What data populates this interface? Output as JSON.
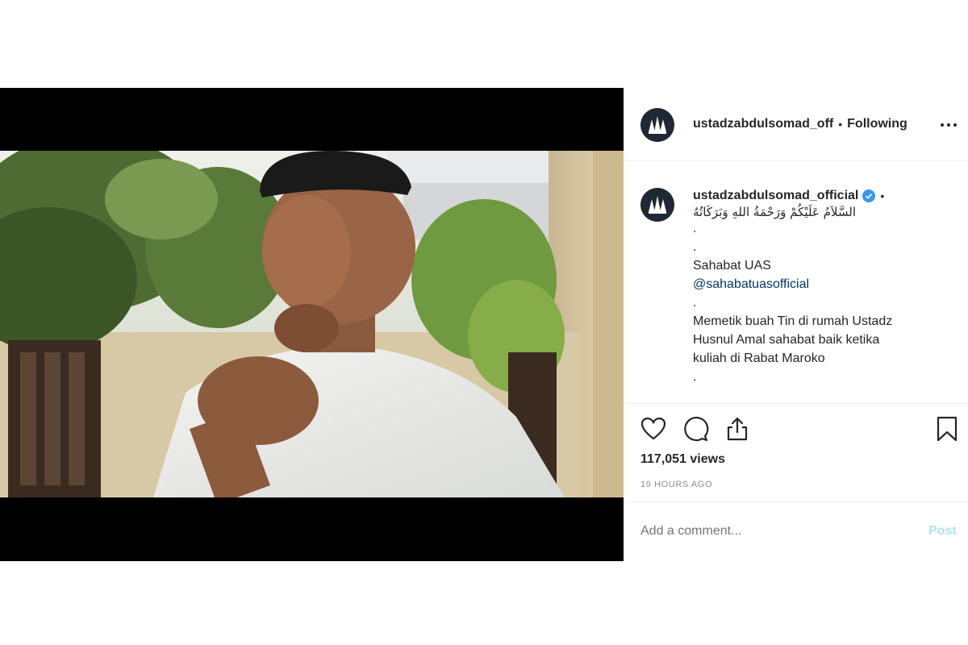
{
  "post": {
    "header": {
      "username": "ustadzabdulsomad_off",
      "separator": "•",
      "follow_status": "Following",
      "avatar_icon": "profile-logo-icon",
      "more_icon": "more-options-icon"
    },
    "caption": {
      "username": "ustadzabdulsomad_official",
      "verified_icon": "verified-badge-icon",
      "separator": "•",
      "arabic_greeting": "السَّلاَمُ عَلَيْكُمْ وَرَحْمَةُ اللهِ وَبَرَكَاتُهُ",
      "dot_1": ".",
      "dot_2": ".",
      "line_sahabat": "Sahabat UAS",
      "mention": "@sahabatuasofficial",
      "dot_3": ".",
      "body_line_1": "Memetik buah Tin di rumah Ustadz",
      "body_line_2": "Husnul Amal sahabat baik ketika",
      "body_line_3": "kuliah di Rabat Maroko",
      "dot_4": "."
    },
    "actions": {
      "like_icon": "heart-icon",
      "comment_icon": "comment-bubble-icon",
      "share_icon": "share-icon",
      "save_icon": "bookmark-icon"
    },
    "views": "117,051 views",
    "timestamp": "19 HOURS AGO",
    "comment_input": {
      "placeholder": "Add a comment...",
      "value": ""
    },
    "post_button": "Post"
  },
  "colors": {
    "link": "#003569",
    "verified": "#3897f0",
    "post_disabled": "#b2dffc",
    "muted": "#8e8e8e"
  }
}
